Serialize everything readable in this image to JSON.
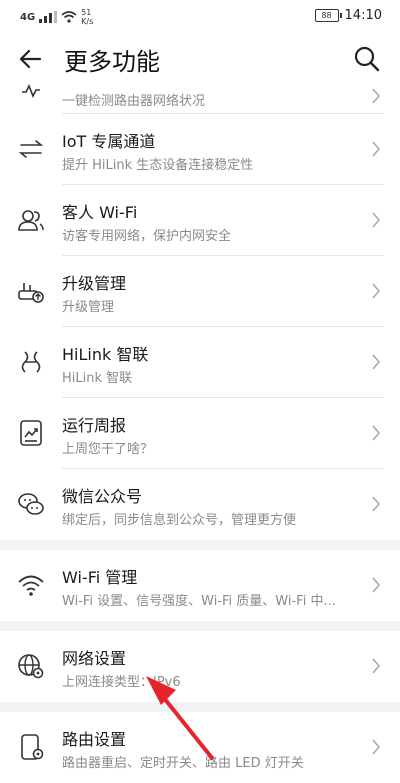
{
  "status_bar": {
    "signal": "4G",
    "speed_value": "51",
    "speed_unit": "K/s",
    "battery": "88",
    "time": "14:10"
  },
  "header": {
    "title": "更多功能"
  },
  "items": [
    {
      "title": "一键体检",
      "subtitle": "一键检测路由器网络状况"
    },
    {
      "title": "IoT 专属通道",
      "subtitle": "提升 HiLink 生态设备连接稳定性"
    },
    {
      "title": "客人 Wi-Fi",
      "subtitle": "访客专用网络，保护内网安全"
    },
    {
      "title": "升级管理",
      "subtitle": "升级管理"
    },
    {
      "title": "HiLink 智联",
      "subtitle": "HiLink 智联"
    },
    {
      "title": "运行周报",
      "subtitle": "上周您干了啥？"
    },
    {
      "title": "微信公众号",
      "subtitle": "绑定后，同步信息到公众号，管理更方便"
    },
    {
      "title": "Wi-Fi 管理",
      "subtitle": "Wi-Fi 设置、信号强度、Wi-Fi 质量、Wi-Fi 中..."
    },
    {
      "title": "网络设置",
      "subtitle": "上网连接类型：IPv6"
    },
    {
      "title": "路由设置",
      "subtitle": "路由器重启、定时开关、路由 LED 灯开关"
    }
  ],
  "colors": {
    "accent_arrow": "#e8222a",
    "divider": "#e6e6e6",
    "section_gap": "#f1f3f5"
  }
}
